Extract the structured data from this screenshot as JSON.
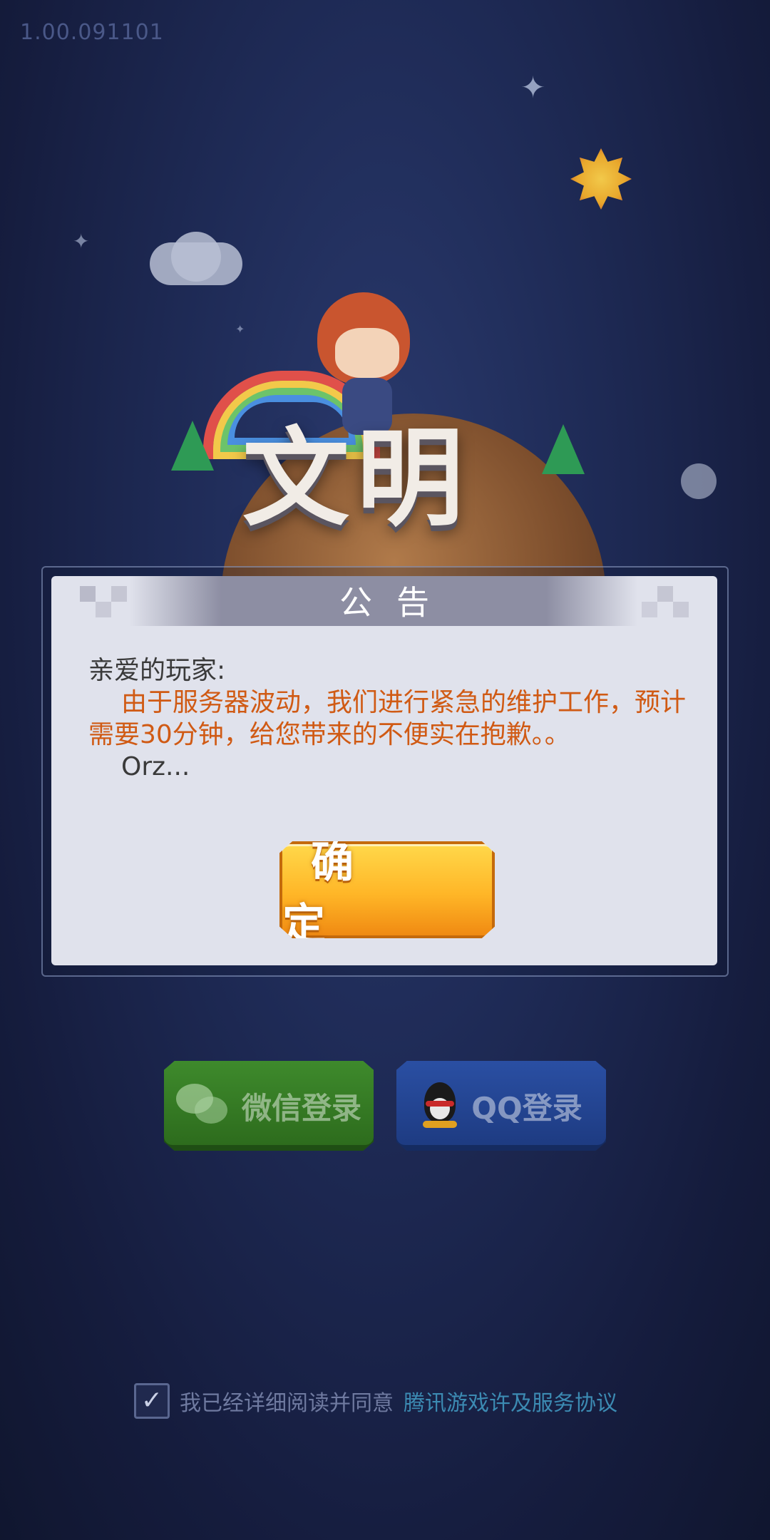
{
  "version": "1.00.091101",
  "game_logo_text": "文明",
  "notice": {
    "title": "公告",
    "greeting": "亲爱的玩家:",
    "message": "由于服务器波动，我们进行紧急的维护工作，预计需要30分钟，给您带来的不便实在抱歉。。",
    "sign_off": "Orz...",
    "confirm_label": "确 定"
  },
  "login": {
    "wechat_label": "微信登录",
    "qq_label": "QQ登录"
  },
  "agreement": {
    "checked": true,
    "check_mark": "✓",
    "text": "我已经详细阅读并同意",
    "link_text": "腾讯游戏许及服务协议"
  },
  "colors": {
    "background": "#1e2a55",
    "message_text": "#d05a14",
    "confirm_button": "#ffb627",
    "wechat_button": "#3e8a2c",
    "qq_button": "#2a4fa3",
    "link": "#3c8bb3"
  }
}
